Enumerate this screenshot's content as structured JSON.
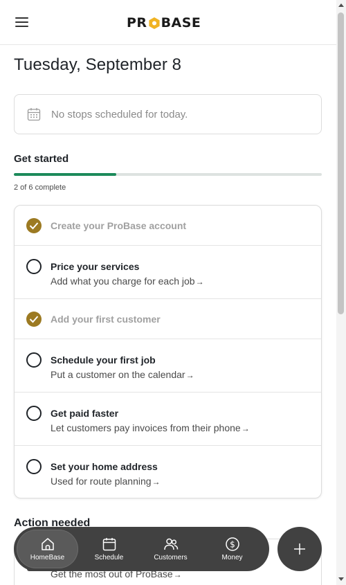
{
  "header": {
    "logo_text": "PROBASE"
  },
  "date_title": "Tuesday, September 8",
  "stops": {
    "message": "No stops scheduled for today."
  },
  "get_started": {
    "title": "Get started",
    "progress_fraction": 0.333,
    "progress_text": "2 of 6 complete",
    "tasks": [
      {
        "title": "Create your ProBase account",
        "subtitle": "",
        "done": true
      },
      {
        "title": "Price your services",
        "subtitle": "Add what you charge for each job",
        "done": false
      },
      {
        "title": "Add your first customer",
        "subtitle": "",
        "done": true
      },
      {
        "title": "Schedule your first job",
        "subtitle": "Put a customer on the calendar",
        "done": false
      },
      {
        "title": "Get paid faster",
        "subtitle": "Let customers pay invoices from their phone",
        "done": false
      },
      {
        "title": "Set your home address",
        "subtitle": "Used for route planning",
        "done": false
      }
    ]
  },
  "action_needed": {
    "title": "Action needed",
    "item_subtitle": "Get the most out of ProBase"
  },
  "arrow_glyph": "→",
  "nav": {
    "items": [
      {
        "label": "HomeBase",
        "icon": "home-icon",
        "active": true
      },
      {
        "label": "Schedule",
        "icon": "calendar-icon",
        "active": false
      },
      {
        "label": "Customers",
        "icon": "users-icon",
        "active": false
      },
      {
        "label": "Money",
        "icon": "dollar-icon",
        "active": false
      }
    ],
    "fab_icon": "plus-icon"
  },
  "colors": {
    "progress": "#1c8a5a",
    "check_done": "#9c7a22",
    "logo_accent": "#f0b323",
    "nav_bg": "#414141"
  }
}
